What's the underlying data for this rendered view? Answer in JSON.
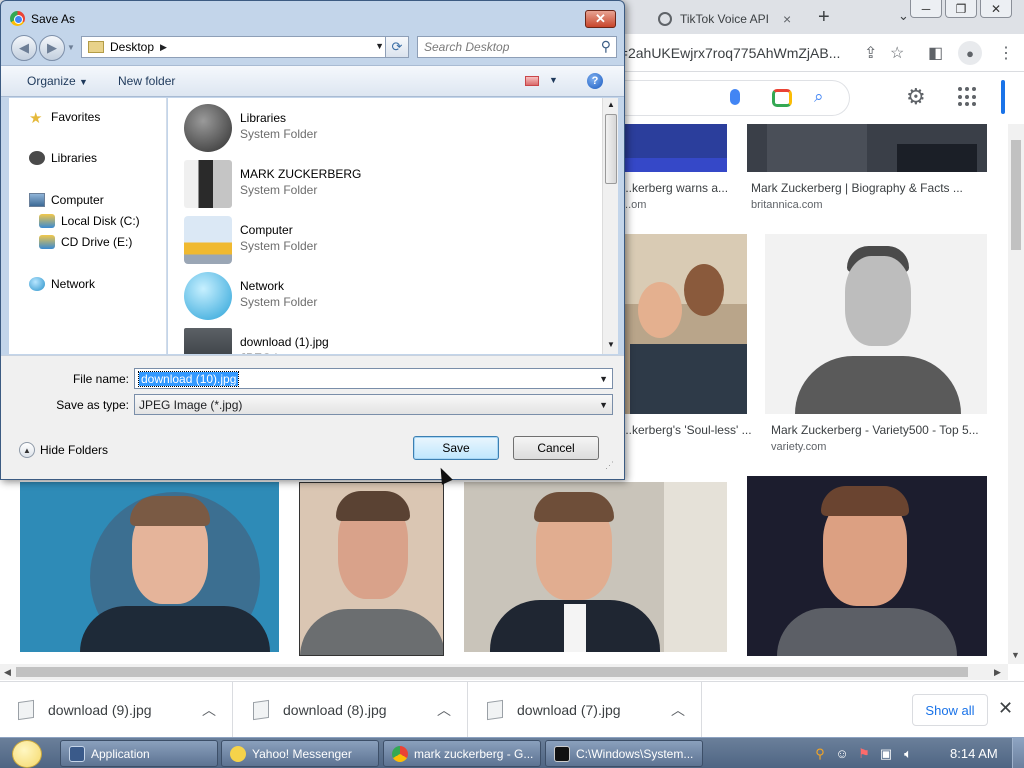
{
  "browser": {
    "tabs": [
      {
        "label": "TikTok Voice API",
        "close": "×"
      }
    ],
    "new_tab": "+",
    "tab_list": "⌄",
    "window_controls": [
      "─",
      "❐",
      "✕"
    ],
    "url_fragment": "d=2ahUKEwjrx7roq775AhWmZjAB..."
  },
  "results": {
    "cards": [
      {
        "title": "...kerberg warns a...",
        "source": "...om"
      },
      {
        "title": "Mark Zuckerberg | Biography & Facts ...",
        "source": "britannica.com"
      },
      {
        "title": "...kerberg's 'Soul-less' ...",
        "source": ""
      },
      {
        "title": "Mark Zuckerberg - Variety500 - Top 5...",
        "source": "variety.com"
      }
    ]
  },
  "downloads": {
    "items": [
      {
        "name": "download (9).jpg"
      },
      {
        "name": "download (8).jpg"
      },
      {
        "name": "download (7).jpg"
      }
    ],
    "show_all": "Show all",
    "close": "✕"
  },
  "taskbar": {
    "items": [
      {
        "label": "Application"
      },
      {
        "label": "Yahoo! Messenger"
      },
      {
        "label": "mark zuckerberg - G..."
      },
      {
        "label": "C:\\Windows\\System..."
      }
    ],
    "clock": "8:14 AM"
  },
  "dialog": {
    "title": "Save As",
    "close": "✕",
    "address": {
      "location": "Desktop"
    },
    "search_placeholder": "Search Desktop",
    "commands": {
      "organize": "Organize",
      "new_folder": "New folder"
    },
    "nav": {
      "favorites": "Favorites",
      "libraries": "Libraries",
      "computer": "Computer",
      "local_disk": "Local Disk (C:)",
      "cd_drive": "CD Drive (E:)",
      "network": "Network"
    },
    "files": [
      {
        "name": "Libraries",
        "type": "System Folder"
      },
      {
        "name": "MARK ZUCKERBERG",
        "type": "System Folder"
      },
      {
        "name": "Computer",
        "type": "System Folder"
      },
      {
        "name": "Network",
        "type": "System Folder"
      },
      {
        "name": "download (1).jpg",
        "type": "JPEG image"
      }
    ],
    "file_name_label": "File name:",
    "file_name_value": "download (10).jpg",
    "save_type_label": "Save as type:",
    "save_type_value": "JPEG Image (*.jpg)",
    "hide_folders": "Hide Folders",
    "save": "Save",
    "cancel": "Cancel"
  }
}
